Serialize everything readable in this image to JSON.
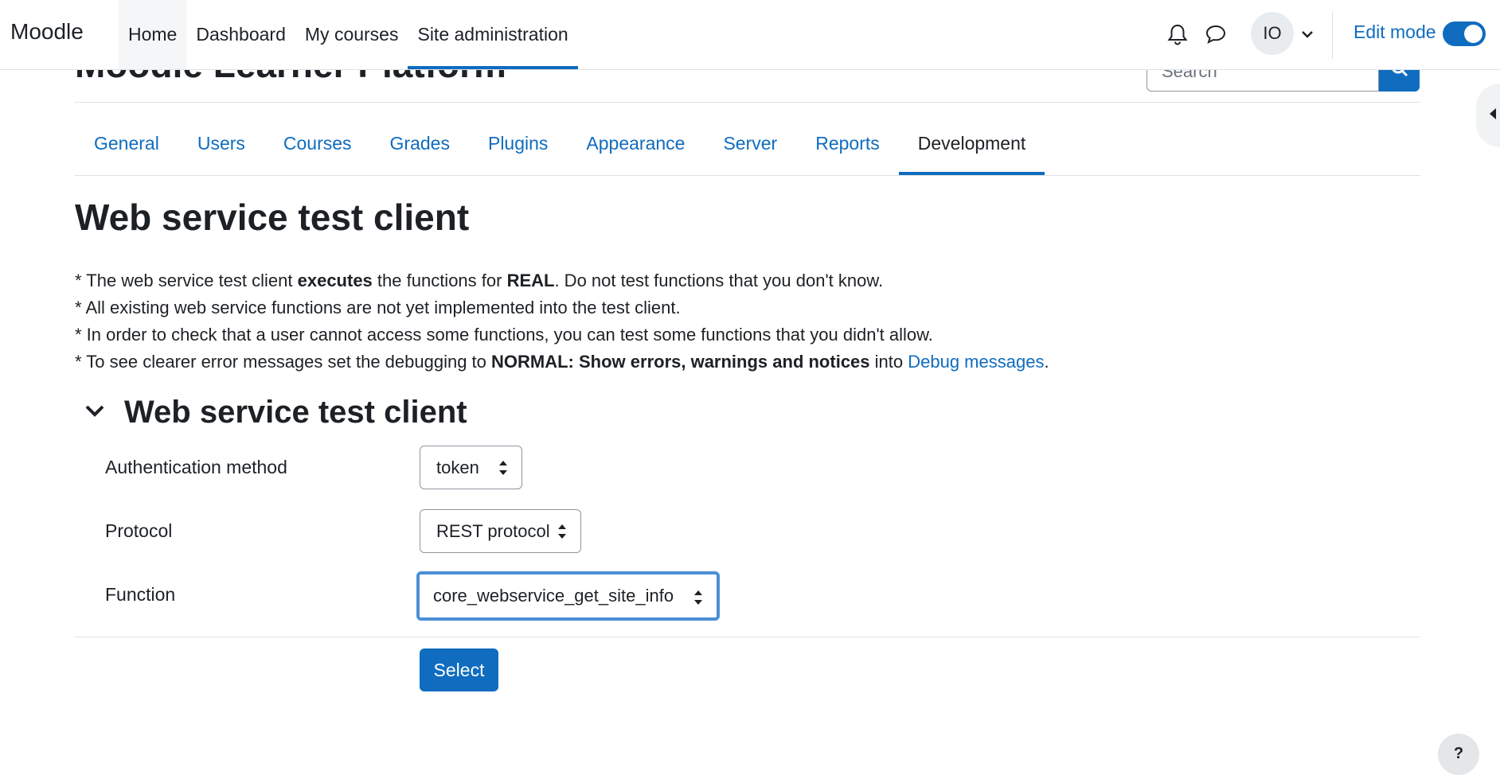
{
  "navbar": {
    "brand": "Moodle",
    "items": [
      {
        "label": "Home"
      },
      {
        "label": "Dashboard"
      },
      {
        "label": "My courses"
      },
      {
        "label": "Site administration"
      }
    ],
    "user_initials": "IO",
    "edit_mode_label": "Edit mode",
    "edit_mode_on": true,
    "icons": [
      "bell-icon",
      "chat-icon",
      "chevron-down-icon"
    ]
  },
  "header": {
    "title": "Moodle Learner Platform",
    "search_placeholder": "Search"
  },
  "tabs": [
    {
      "label": "General"
    },
    {
      "label": "Users"
    },
    {
      "label": "Courses"
    },
    {
      "label": "Grades"
    },
    {
      "label": "Plugins"
    },
    {
      "label": "Appearance"
    },
    {
      "label": "Server"
    },
    {
      "label": "Reports"
    },
    {
      "label": "Development",
      "active": true
    }
  ],
  "main": {
    "title": "Web service test client",
    "notes": {
      "n1_pre": "* The web service test client ",
      "n1_b1": "executes",
      "n1_mid": " the functions for ",
      "n1_b2": "REAL",
      "n1_post": ". Do not test functions that you don't know.",
      "n2": "* All existing web service functions are not yet implemented into the test client.",
      "n3": "* In order to check that a user cannot access some functions, you can test some functions that you didn't allow.",
      "n4_pre": "* To see clearer error messages set the debugging to ",
      "n4_b": "NORMAL: Show errors, warnings and notices",
      "n4_mid": " into ",
      "n4_link": "Debug messages",
      "n4_post": "."
    },
    "section_title": "Web service test client",
    "form": {
      "auth_label": "Authentication method",
      "auth_value": "token",
      "protocol_label": "Protocol",
      "protocol_value": "REST protocol",
      "function_label": "Function",
      "function_value": "core_webservice_get_site_info",
      "submit_label": "Select"
    }
  },
  "help_label": "?",
  "colors": {
    "accent": "#0f6cbf",
    "focus_ring": "#4c8fd6",
    "text": "#1d2125",
    "border": "#dee2e6"
  }
}
